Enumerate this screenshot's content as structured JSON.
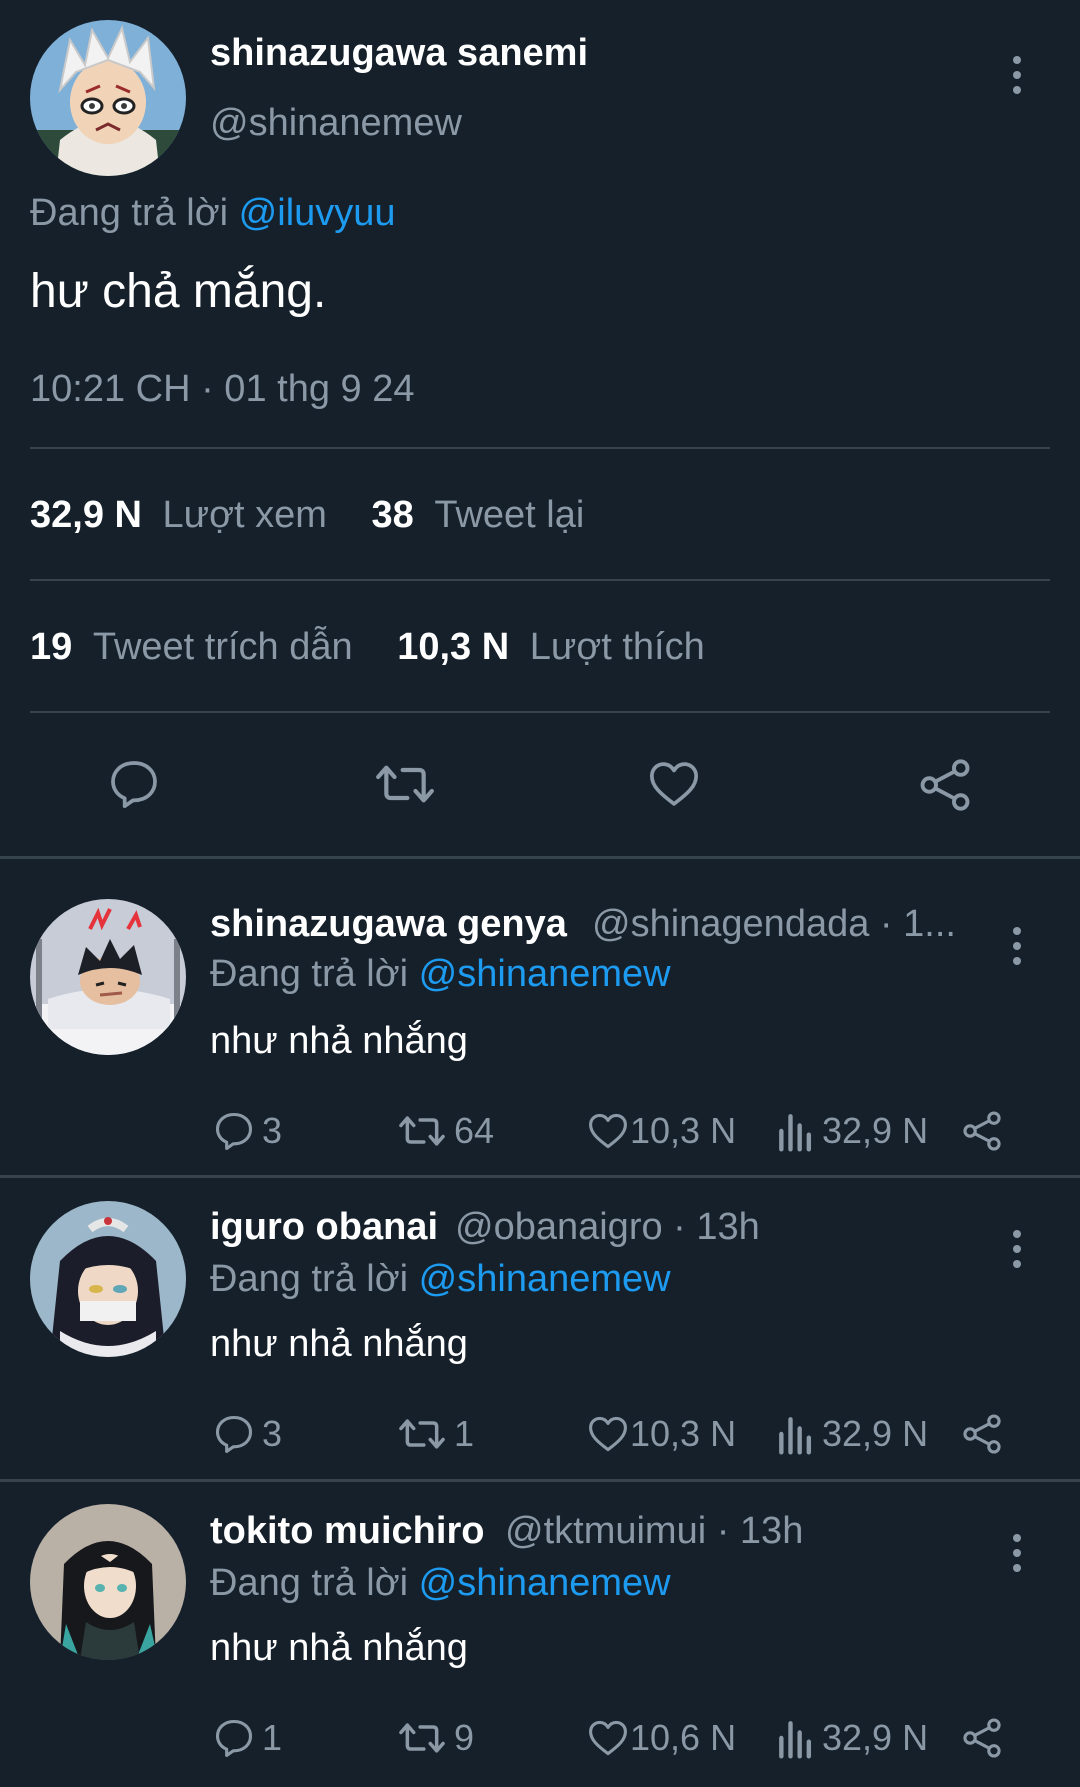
{
  "main_tweet": {
    "author_name": "shinazugawa sanemi",
    "handle": "@shinanemew",
    "replying_prefix": "Đang trả lời",
    "replying_to": "@iluvyuu",
    "text": "hư chả mắng.",
    "timestamp": "10:21 CH · 01 thg 9 24",
    "stats": {
      "views_count": "32,9 N",
      "views_label": "Lượt xem",
      "retweets_count": "38",
      "retweets_label": "Tweet lại",
      "quotes_count": "19",
      "quotes_label": "Tweet trích dẫn",
      "likes_count": "10,3 N",
      "likes_label": "Lượt thích"
    },
    "actions": [
      "reply-icon",
      "retweet-icon",
      "heart-icon",
      "share-icon"
    ]
  },
  "replies": [
    {
      "author_name": "shinazugawa genya",
      "handle_time": "@shinagendada · 1...",
      "replying_prefix": "Đang trả lời",
      "replying_to": "@shinanemew",
      "text": "như nhả nhắng",
      "replies": "3",
      "retweets": "64",
      "likes": "10,3 N",
      "views": "32,9 N"
    },
    {
      "author_name": "iguro obanai",
      "handle_time": "@obanaigro · 13h",
      "replying_prefix": "Đang trả lời",
      "replying_to": "@shinanemew",
      "text": "như nhả nhắng",
      "replies": "3",
      "retweets": "1",
      "likes": "10,3 N",
      "views": "32,9 N"
    },
    {
      "author_name": "tokito muichiro",
      "handle_time": "@tktmuimui · 13h",
      "replying_prefix": "Đang trả lời",
      "replying_to": "@shinanemew",
      "text": "như nhả nhắng",
      "replies": "1",
      "retweets": "9",
      "likes": "10,6 N",
      "views": "32,9 N"
    }
  ],
  "colors": {
    "background": "#15202b",
    "muted": "#8b98a5",
    "link": "#1d9bf0",
    "divider": "#38444d"
  }
}
